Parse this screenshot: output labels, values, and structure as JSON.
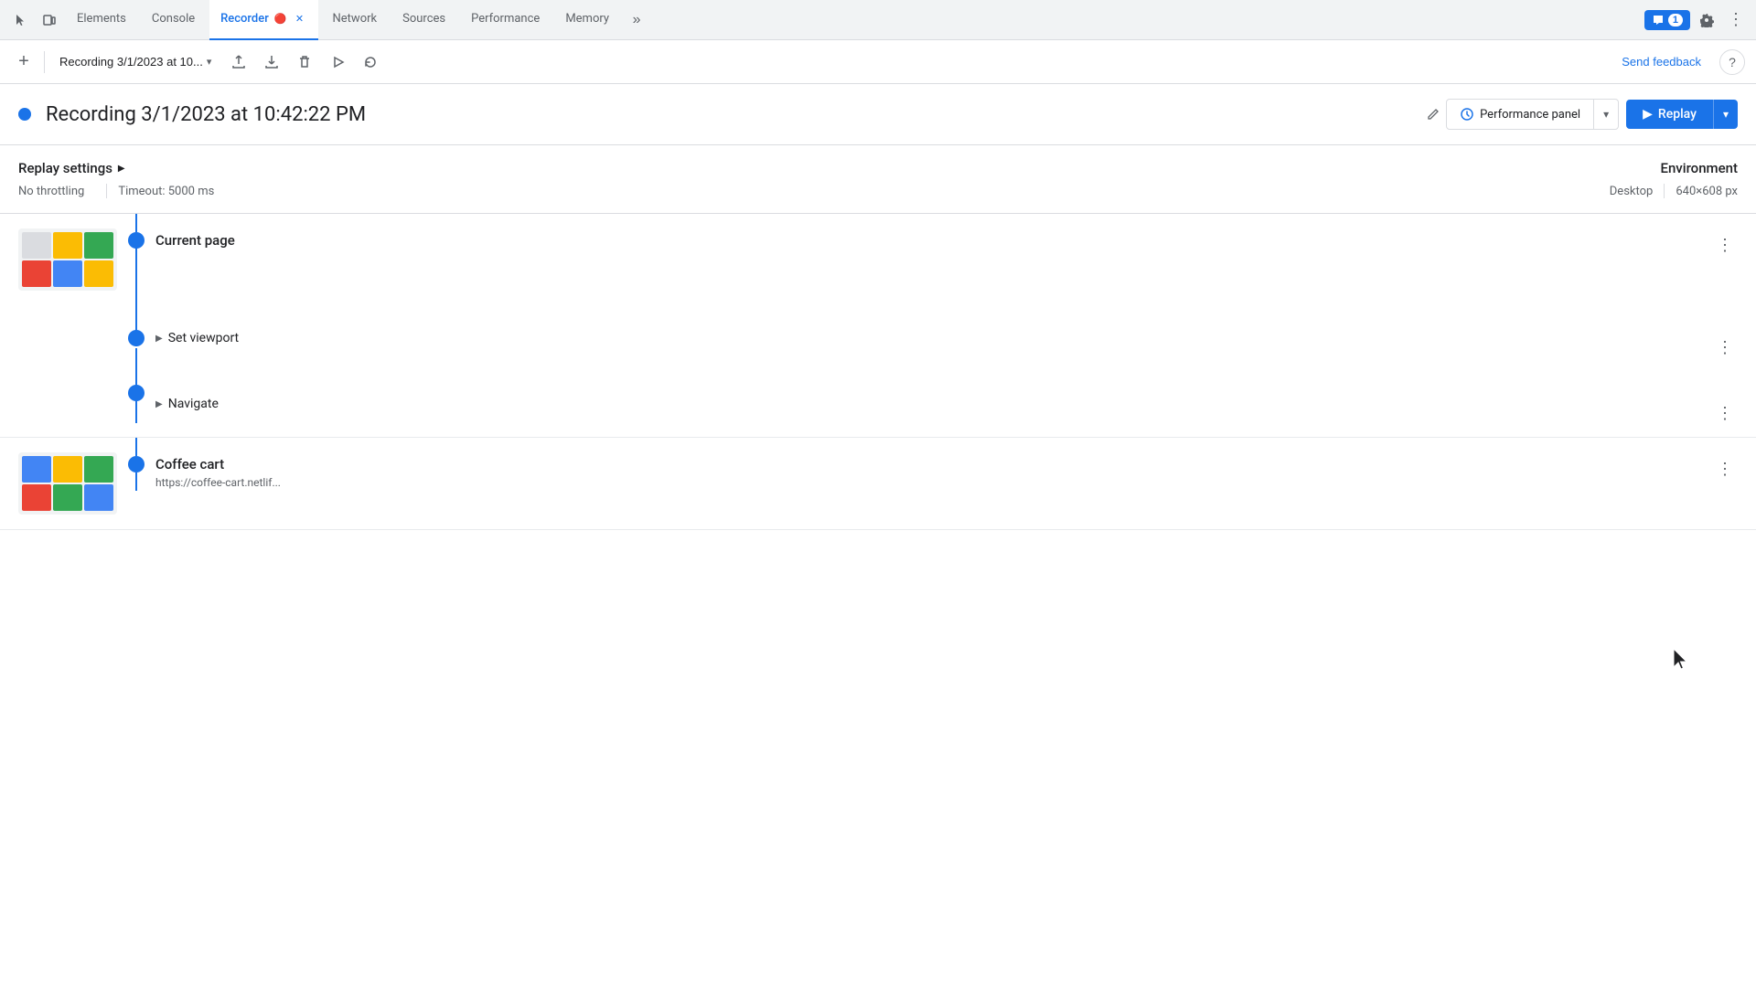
{
  "tabs": {
    "items": [
      {
        "label": "Elements",
        "active": false,
        "closeable": false
      },
      {
        "label": "Console",
        "active": false,
        "closeable": false
      },
      {
        "label": "Recorder",
        "active": true,
        "closeable": true
      },
      {
        "label": "Network",
        "active": false,
        "closeable": false
      },
      {
        "label": "Sources",
        "active": false,
        "closeable": false
      },
      {
        "label": "Performance",
        "active": false,
        "closeable": false
      },
      {
        "label": "Memory",
        "active": false,
        "closeable": false
      }
    ],
    "more_label": "»",
    "chat_badge": "1",
    "settings_label": "⚙",
    "more_vert_label": "⋮"
  },
  "toolbar": {
    "add_label": "+",
    "recording_name": "Recording 3/1/2023 at 10...",
    "chevron_label": "▾",
    "upload_label": "↑",
    "download_label": "↓",
    "delete_label": "🗑",
    "play_label": "▷",
    "replay_loop_label": "↺",
    "send_feedback_label": "Send feedback",
    "help_label": "?"
  },
  "recording_header": {
    "title": "Recording 3/1/2023 at 10:42:22 PM",
    "edit_icon": "✎",
    "perf_panel_label": "Performance panel",
    "perf_icon": "⚡",
    "chevron_label": "▾",
    "replay_label": "Replay",
    "play_icon": "▶"
  },
  "settings": {
    "title": "Replay settings",
    "expand_icon": "▶",
    "throttling": "No throttling",
    "timeout": "Timeout: 5000 ms",
    "environment_title": "Environment",
    "device": "Desktop",
    "resolution": "640×608 px"
  },
  "steps": [
    {
      "id": "step-1",
      "has_thumbnail": true,
      "name": "Current page",
      "url": "",
      "sub_steps": [
        {
          "name": "Set viewport",
          "expandable": true
        },
        {
          "name": "Navigate",
          "expandable": true
        }
      ]
    },
    {
      "id": "step-2",
      "has_thumbnail": true,
      "name": "Coffee cart",
      "url": "https://coffee-cart.netlif..."
    }
  ],
  "icons": {
    "cursor": "⌖",
    "three_dots": "⋮",
    "edit_pencil": "✏"
  },
  "colors": {
    "blue": "#1a73e8",
    "light_bg": "#f1f3f4",
    "border": "#dadce0",
    "text_secondary": "#5f6368"
  }
}
